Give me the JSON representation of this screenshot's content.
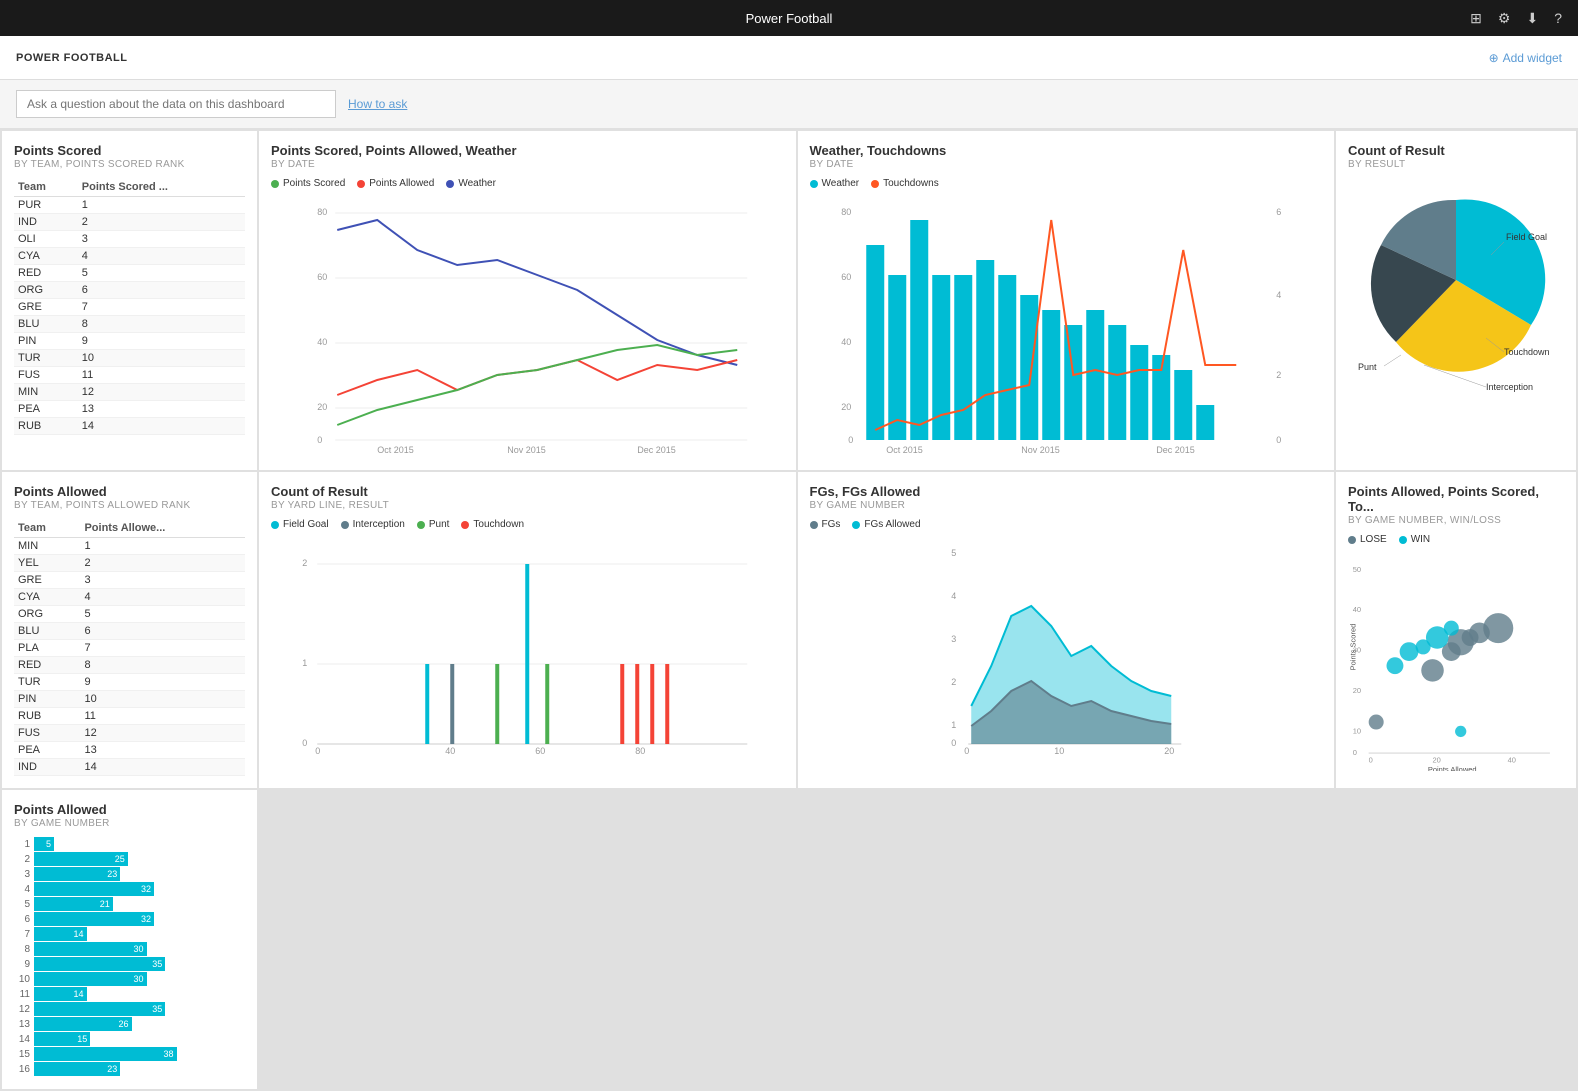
{
  "topBar": {
    "title": "Power Football",
    "icons": [
      "layout-icon",
      "gear-icon",
      "download-icon",
      "help-icon"
    ]
  },
  "subHeader": {
    "title": "POWER FOOTBALL",
    "addWidget": "Add widget"
  },
  "questionBar": {
    "placeholder": "Ask a question about the data on this dashboard",
    "howToAsk": "How to ask"
  },
  "widgets": {
    "pointsScored": {
      "title": "Points Scored",
      "subtitle": "BY TEAM, POINTS SCORED RANK",
      "columns": [
        "Team",
        "Points Scored ..."
      ],
      "rows": [
        [
          "PUR",
          "1"
        ],
        [
          "IND",
          "2"
        ],
        [
          "OLI",
          "3"
        ],
        [
          "CYA",
          "4"
        ],
        [
          "RED",
          "5"
        ],
        [
          "ORG",
          "6"
        ],
        [
          "GRE",
          "7"
        ],
        [
          "BLU",
          "8"
        ],
        [
          "PIN",
          "9"
        ],
        [
          "TUR",
          "10"
        ],
        [
          "FUS",
          "11"
        ],
        [
          "MIN",
          "12"
        ],
        [
          "PEA",
          "13"
        ],
        [
          "RUB",
          "14"
        ]
      ]
    },
    "pointsScoredAllowedWeather": {
      "title": "Points Scored, Points Allowed, Weather",
      "subtitle": "BY DATE",
      "legend": [
        {
          "label": "Points Scored",
          "color": "#4caf50"
        },
        {
          "label": "Points Allowed",
          "color": "#f44336"
        },
        {
          "label": "Weather",
          "color": "#3f51b5"
        }
      ],
      "xLabels": [
        "Oct 2015",
        "Nov 2015",
        "Dec 2015"
      ],
      "yMax": 80
    },
    "weatherTouchdowns": {
      "title": "Weather, Touchdowns",
      "subtitle": "BY DATE",
      "legend": [
        {
          "label": "Weather",
          "color": "#00bcd4"
        },
        {
          "label": "Touchdowns",
          "color": "#ff5722"
        }
      ],
      "xLabels": [
        "Oct 2015",
        "Nov 2015",
        "Dec 2015"
      ],
      "yMax": 80
    },
    "countOfResult": {
      "title": "Count of Result",
      "subtitle": "BY RESULT",
      "legend": [
        {
          "label": "Touchdown",
          "color": "#f5c518"
        },
        {
          "label": "Field Goal",
          "color": "#00bcd4"
        },
        {
          "label": "Punt",
          "color": "#607d8b"
        },
        {
          "label": "Interception",
          "color": "#f44336"
        }
      ],
      "pieSlices": [
        {
          "label": "Touchdown",
          "value": 30,
          "color": "#f5c518"
        },
        {
          "label": "Field Goal",
          "value": 35,
          "color": "#00bcd4"
        },
        {
          "label": "Punt",
          "value": 15,
          "color": "#607d8b"
        },
        {
          "label": "Interception",
          "value": 20,
          "color": "#f44336"
        }
      ]
    },
    "pointsAllowed": {
      "title": "Points Allowed",
      "subtitle": "BY TEAM, POINTS ALLOWED RANK",
      "columns": [
        "Team",
        "Points Allowe..."
      ],
      "rows": [
        [
          "MIN",
          "1"
        ],
        [
          "YEL",
          "2"
        ],
        [
          "GRE",
          "3"
        ],
        [
          "CYA",
          "4"
        ],
        [
          "ORG",
          "5"
        ],
        [
          "BLU",
          "6"
        ],
        [
          "PLA",
          "7"
        ],
        [
          "RED",
          "8"
        ],
        [
          "TUR",
          "9"
        ],
        [
          "PIN",
          "10"
        ],
        [
          "RUB",
          "11"
        ],
        [
          "FUS",
          "12"
        ],
        [
          "PEA",
          "13"
        ],
        [
          "IND",
          "14"
        ]
      ]
    },
    "countOfResultByYard": {
      "title": "Count of Result",
      "subtitle": "BY YARD LINE, RESULT",
      "legend": [
        {
          "label": "Field Goal",
          "color": "#00bcd4"
        },
        {
          "label": "Interception",
          "color": "#607d8b"
        },
        {
          "label": "Punt",
          "color": "#4caf50"
        },
        {
          "label": "Touchdown",
          "color": "#f44336"
        }
      ],
      "xLabels": [
        "0",
        "40",
        "60",
        "80"
      ],
      "yMax": 2
    },
    "fgsAllowed": {
      "title": "FGs, FGs Allowed",
      "subtitle": "BY GAME NUMBER",
      "legend": [
        {
          "label": "FGs",
          "color": "#607d8b"
        },
        {
          "label": "FGs Allowed",
          "color": "#00bcd4"
        }
      ],
      "xLabels": [
        "0",
        "10",
        "20"
      ],
      "yMax": 5
    },
    "pointsAllowedScored": {
      "title": "Points Allowed, Points Scored, To...",
      "subtitle": "BY GAME NUMBER, WIN/LOSS",
      "legend": [
        {
          "label": "LOSE",
          "color": "#607d8b"
        },
        {
          "label": "WIN",
          "color": "#00bcd4"
        }
      ],
      "xLabel": "Points Allowed",
      "yLabel": "Points Scored",
      "xMax": 40,
      "yMax": 50
    },
    "pointsAllowedByGame": {
      "title": "Points Allowed",
      "subtitle": "BY GAME NUMBER",
      "bars": [
        {
          "game": "1",
          "value": 5
        },
        {
          "game": "2",
          "value": 25
        },
        {
          "game": "3",
          "value": 23
        },
        {
          "game": "4",
          "value": 32
        },
        {
          "game": "5",
          "value": 21
        },
        {
          "game": "6",
          "value": 32
        },
        {
          "game": "7",
          "value": 14
        },
        {
          "game": "8",
          "value": 30
        },
        {
          "game": "9",
          "value": 35
        },
        {
          "game": "10",
          "value": 30
        },
        {
          "game": "11",
          "value": 14
        },
        {
          "game": "12",
          "value": 35
        },
        {
          "game": "13",
          "value": 26
        },
        {
          "game": "14",
          "value": 15
        },
        {
          "game": "15",
          "value": 38
        },
        {
          "game": "16",
          "value": 23
        }
      ],
      "maxValue": 40
    }
  }
}
